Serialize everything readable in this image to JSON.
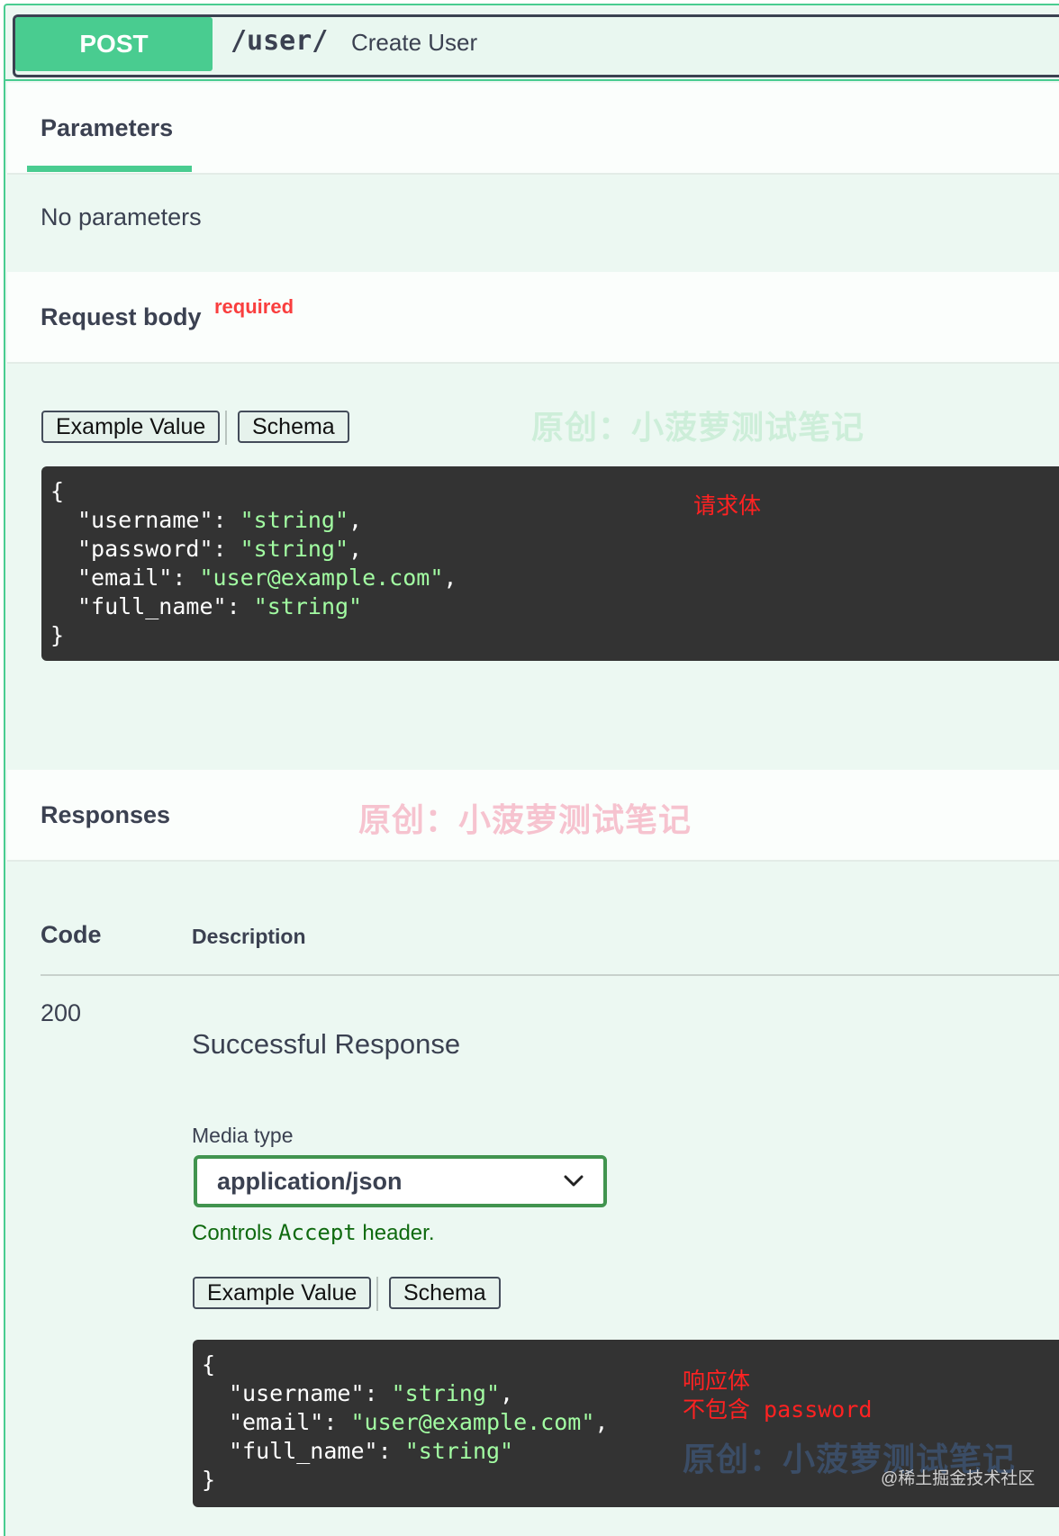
{
  "operation": {
    "method": "POST",
    "path": "/user/",
    "summary": "Create User"
  },
  "parameters": {
    "tab_label": "Parameters",
    "empty_text": "No parameters"
  },
  "request_body": {
    "title": "Request body",
    "required_label": "required",
    "example_tab": "Example Value",
    "schema_tab": "Schema",
    "code_lines": [
      {
        "key": "\"username\"",
        "value": "\"string\"",
        "trail": ","
      },
      {
        "key": "\"password\"",
        "value": "\"string\"",
        "trail": ","
      },
      {
        "key": "\"email\"",
        "value": "\"user@example.com\"",
        "trail": ","
      },
      {
        "key": "\"full_name\"",
        "value": "\"string\"",
        "trail": ""
      }
    ],
    "open_brace": "{",
    "close_brace": "}",
    "annotation": "请求体",
    "watermark": "原创：小菠萝测试笔记"
  },
  "responses": {
    "title": "Responses",
    "watermark": "原创：小菠萝测试笔记",
    "col_code": "Code",
    "col_description": "Description",
    "rows": [
      {
        "code": "200",
        "description": "Successful Response",
        "media_type_label": "Media type",
        "media_type_value": "application/json",
        "controls_prefix": "Controls ",
        "controls_code": "Accept",
        "controls_suffix": " header.",
        "example_tab": "Example Value",
        "schema_tab": "Schema",
        "open_brace": "{",
        "close_brace": "}",
        "code_lines": [
          {
            "key": "\"username\"",
            "value": "\"string\"",
            "trail": ","
          },
          {
            "key": "\"email\"",
            "value": "\"user@example.com\"",
            "trail": ","
          },
          {
            "key": "\"full_name\"",
            "value": "\"string\"",
            "trail": ""
          }
        ],
        "annotation_line1": "响应体",
        "annotation_line2": "不包含 password",
        "watermark": "原创：小菠萝测试笔记"
      }
    ]
  },
  "footer_watermark": "@稀土掘金技术社区",
  "colors": {
    "method_green": "#49cc90",
    "background": "#ecf8f2",
    "code_bg": "#333333",
    "string_green": "#a2fca2",
    "required_red": "#f93e3e",
    "annotation_red": "#ff2222",
    "select_border": "#41944f"
  },
  "icons": {
    "select_chevron": "chevron-down-icon"
  }
}
